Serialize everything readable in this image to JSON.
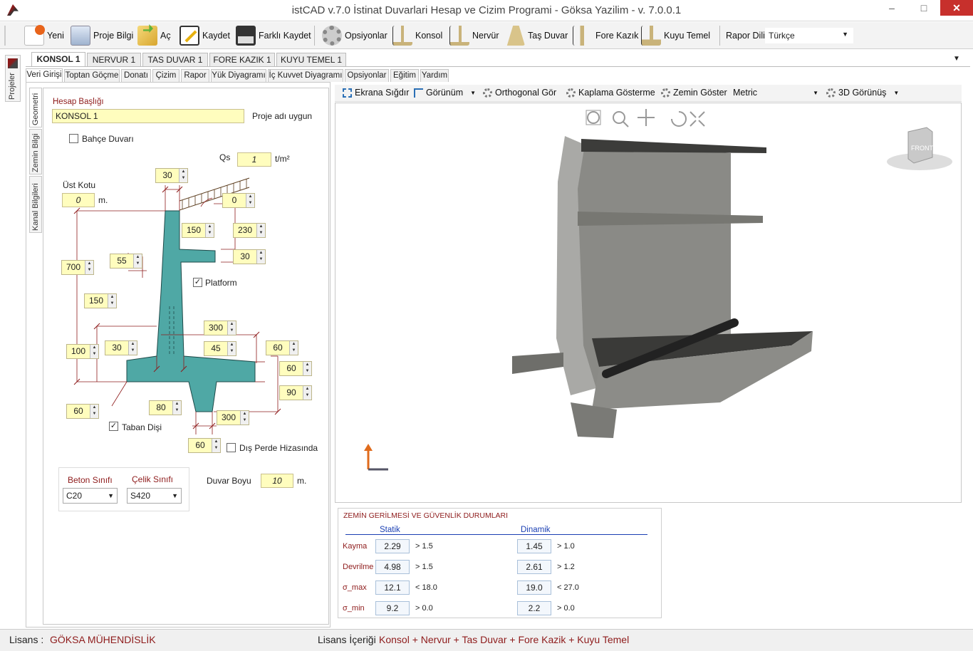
{
  "window": {
    "title": "istCAD v.7.0 İstinat Duvarlari Hesap ve Cizim Programi - Göksa Yazilim - v. 7.0.0.1",
    "minimize": "–",
    "maximize": "□",
    "close": "✕"
  },
  "toolbar": {
    "yeni": "Yeni",
    "proje_bilgi": "Proje Bilgi",
    "ac": "Aç",
    "kaydet": "Kaydet",
    "farkli_kaydet": "Farklı Kaydet",
    "opsiyonlar": "Opsiyonlar",
    "konsol": "Konsol",
    "nervur": "Nervür",
    "tas_duvar": "Taş Duvar",
    "fore_kazik": "Fore Kazık",
    "kuyu_temel": "Kuyu Temel",
    "rapor_dili": "Rapor Dili",
    "lang_value": "Türkçe"
  },
  "side": {
    "projeler": "Projeler"
  },
  "doc_tabs": [
    "KONSOL 1",
    "NERVUR 1",
    "TAS DUVAR 1",
    "FORE KAZIK 1",
    "KUYU TEMEL 1"
  ],
  "sub_tabs": [
    "Veri Girişi",
    "Toptan Göçme",
    "Donatı",
    "Çizim",
    "Rapor",
    "Yük Diyagramı",
    "İç Kuvvet Diyagramı",
    "Opsiyonlar",
    "Eğitim",
    "Yardım"
  ],
  "vtabs": [
    "Geometri",
    "Zemin Bilgi",
    "Kanal Bilgileri"
  ],
  "geo": {
    "hesap_basligi_label": "Hesap Başlığı",
    "hesap_basligi": "KONSOL 1",
    "proje_adi_uygun": "Proje adı uygun",
    "bahce_duvari": "Bahçe Duvarı",
    "qs_label": "Qs",
    "qs_value": "1",
    "qs_unit": "t/m²",
    "ust_kotu_label": "Üst Kotu",
    "ust_kotu": "0",
    "ust_kotu_unit": "m.",
    "platform": "Platform",
    "taban_disi": "Taban Dişi",
    "dis_perde": "Dış Perde Hizasında",
    "spin_values": {
      "s30a": "30",
      "s0": "0",
      "s150a": "150",
      "s230": "230",
      "s55": "55",
      "s30b": "30",
      "s700": "700",
      "s150b": "150",
      "s300a": "300",
      "s100": "100",
      "s30c": "30",
      "s45": "45",
      "s60a": "60",
      "s60b": "60",
      "s90": "90",
      "s80": "80",
      "s300b": "300",
      "s60c": "60",
      "s60d": "60"
    },
    "beton_label": "Beton Sınıfı",
    "beton_value": "C20",
    "celik_label": "Çelik Sınıfı",
    "celik_value": "S420",
    "duvar_boyu_label": "Duvar Boyu",
    "duvar_boyu": "10",
    "duvar_boyu_unit": "m."
  },
  "viewer": {
    "ekrana_sigdir": "Ekrana Sığdır",
    "gorunum": "Görünüm",
    "orthogonal": "Orthogonal Gör",
    "kaplama": "Kaplama Gösterme",
    "zemin_goster": "Zemin Göster",
    "units": "Metric",
    "gorunum_3d": "3D Görünüş",
    "cube_label": "FRONT"
  },
  "results": {
    "title": "ZEMİN GERİLMESİ VE GÜVENLİK DURUMLARI",
    "statik": "Statik",
    "dinamik": "Dinamik",
    "rows": [
      {
        "label": "Kayma",
        "s": "2.29",
        "sl": "> 1.5",
        "d": "1.45",
        "dl": "> 1.0"
      },
      {
        "label": "Devrilme",
        "s": "4.98",
        "sl": "> 1.5",
        "d": "2.61",
        "dl": "> 1.2"
      },
      {
        "label": "σ_max",
        "s": "12.1",
        "sl": "< 18.0",
        "d": "19.0",
        "dl": "< 27.0"
      },
      {
        "label": "σ_min",
        "s": "9.2",
        "sl": "> 0.0",
        "d": "2.2",
        "dl": "> 0.0"
      }
    ]
  },
  "status": {
    "lisans_label": "Lisans :",
    "lisans_value": "GÖKSA MÜHENDİSLİK",
    "icerik_label": "Lisans İçeriği",
    "icerik_value": "Konsol + Nervur + Tas Duvar + Fore Kazik + Kuyu Temel"
  }
}
